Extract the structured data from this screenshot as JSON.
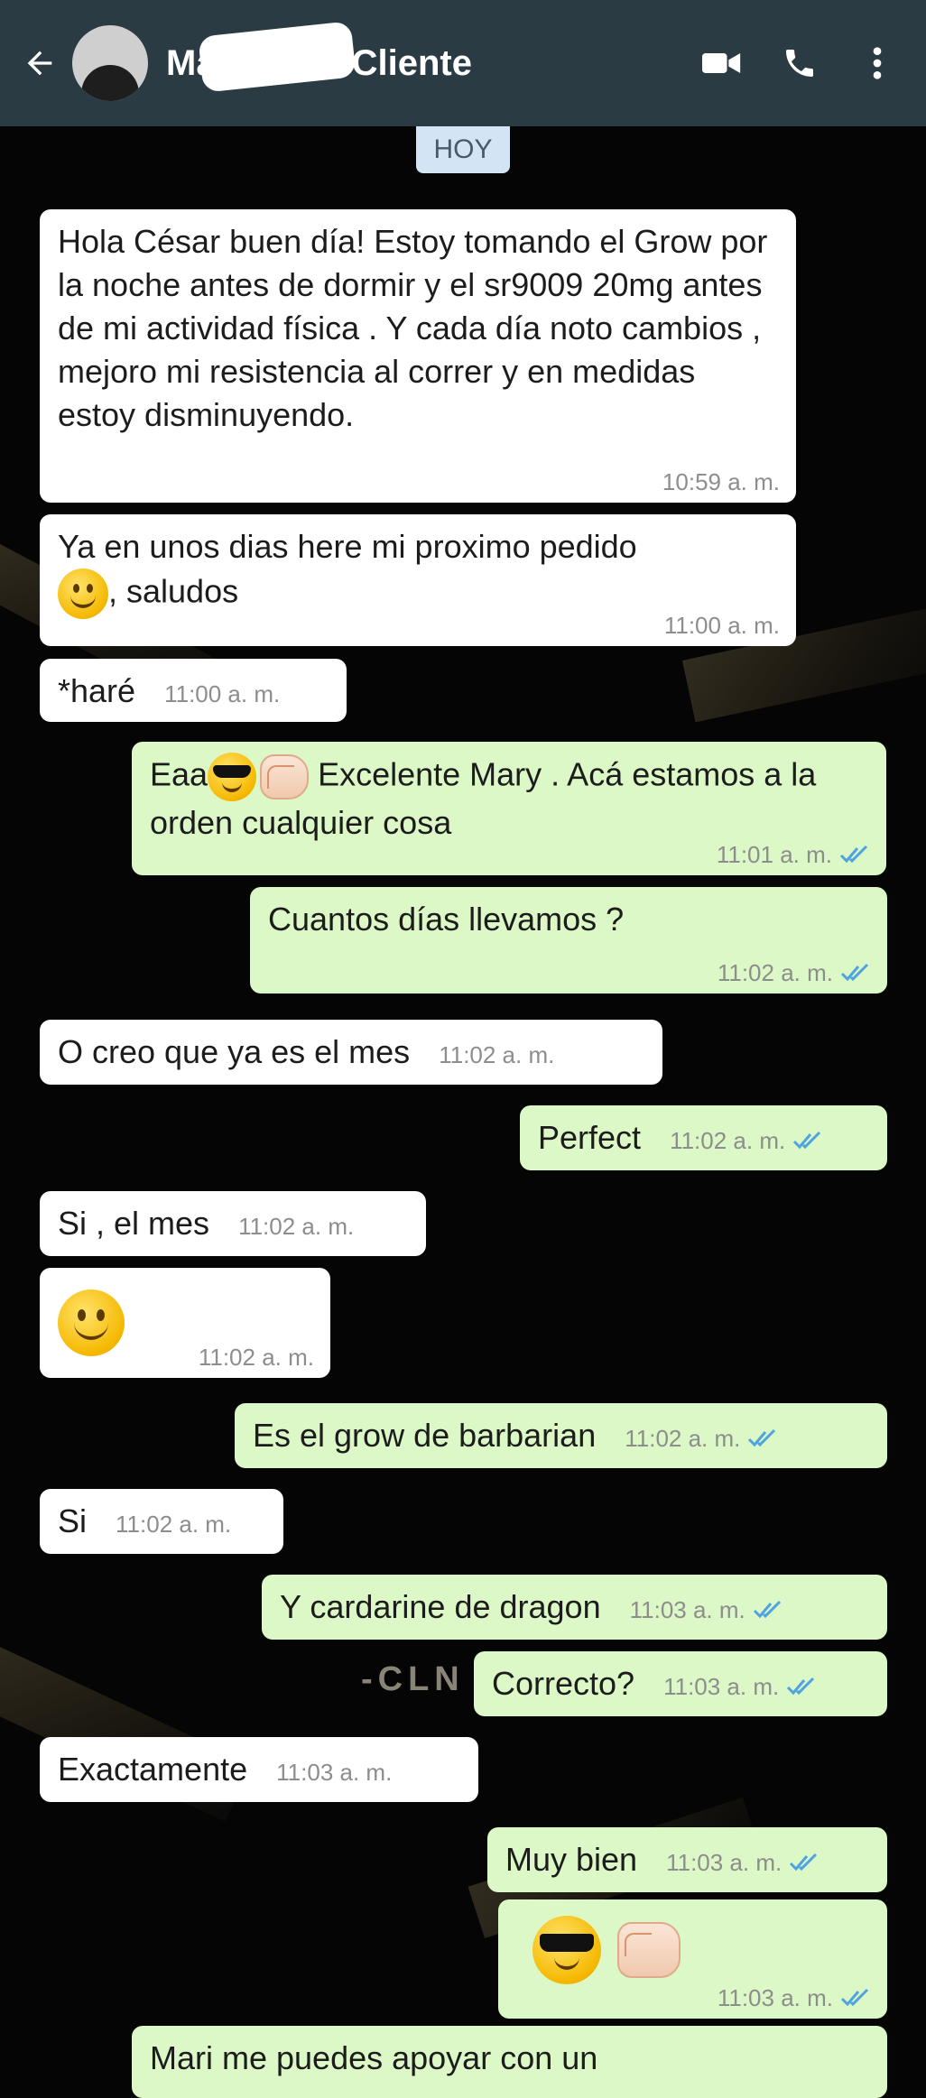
{
  "header": {
    "name_prefix": "Ma",
    "name_suffix": "Cliente"
  },
  "date_chip": "HOY",
  "messages": [
    {
      "dir": "in",
      "text": "Hola César buen día! Estoy tomando el Grow por la noche antes de dormir y el sr9009 20mg antes de mi actividad física . Y cada día noto cambios , mejoro mi resistencia al correr y en medidas estoy disminuyendo.",
      "time": "10:59 a. m."
    },
    {
      "dir": "in",
      "text": "Ya en unos dias here mi proximo pedido",
      "text2": ", saludos",
      "time": "11:00 a. m."
    },
    {
      "dir": "in",
      "text": "*haré",
      "time": "11:00 a. m."
    },
    {
      "dir": "out",
      "text_a": "Eaa",
      "text_b": " Excelente Mary . Acá estamos a la orden cualquier cosa",
      "time": "11:01 a. m."
    },
    {
      "dir": "out",
      "text": "Cuantos días llevamos ?",
      "time": "11:02 a. m."
    },
    {
      "dir": "in",
      "text": "O creo que ya es el mes",
      "time": "11:02 a. m."
    },
    {
      "dir": "out",
      "text": "Perfect",
      "time": "11:02 a. m."
    },
    {
      "dir": "in",
      "text": "Si , el mes",
      "time": "11:02 a. m."
    },
    {
      "dir": "in",
      "text": "",
      "time": "11:02 a. m."
    },
    {
      "dir": "out",
      "text": "Es el grow de barbarian",
      "time": "11:02 a. m."
    },
    {
      "dir": "in",
      "text": "Si",
      "time": "11:02 a. m."
    },
    {
      "dir": "out",
      "text": "Y cardarine de dragon",
      "time": "11:03 a. m."
    },
    {
      "dir": "out",
      "text": "Correcto?",
      "time": "11:03 a. m."
    },
    {
      "dir": "in",
      "text": "Exactamente",
      "time": "11:03 a. m."
    },
    {
      "dir": "out",
      "text": "Muy bien",
      "time": "11:03 a. m."
    },
    {
      "dir": "out",
      "text": "",
      "time": "11:03 a. m."
    },
    {
      "dir": "out",
      "text": "Mari me puedes apoyar con un",
      "time": ""
    }
  ],
  "wallpaper_text": "-CLN",
  "colors": {
    "header_bg": "#2a3b43",
    "incoming_bubble": "#ffffff",
    "outgoing_bubble": "#dcf8c6",
    "read_ticks": "#4fa3e0",
    "date_chip_bg": "#d3e4f4"
  },
  "icons": [
    "back-arrow-icon",
    "video-call-icon",
    "phone-icon",
    "more-vert-icon",
    "double-check-icon",
    "smiley-emoji",
    "sunglasses-emoji",
    "fist-bump-emoji"
  ]
}
